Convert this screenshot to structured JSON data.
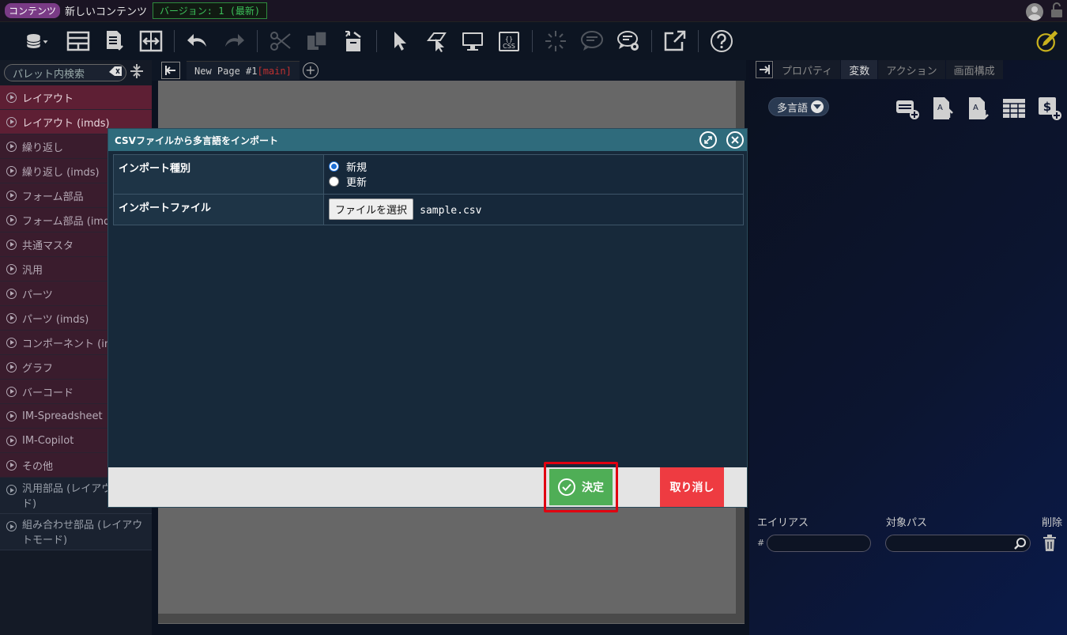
{
  "titlebar": {
    "tag": "コンテンツ",
    "title": "新しいコンテンツ",
    "version": "バージョン: 1 (最新)"
  },
  "toolbar": {
    "icons": [
      "database-icon",
      "layout-icon",
      "download-icon",
      "resize-icon",
      "undo-icon",
      "redo-icon",
      "cut-icon",
      "copy-icon",
      "paste-icon",
      "pointer-icon",
      "select-area-icon",
      "monitor-icon",
      "css-icon",
      "spinner-icon",
      "comment-icon",
      "comment-settings-icon",
      "external-link-icon",
      "help-icon",
      "edit-icon"
    ],
    "css_label": "CSS"
  },
  "palette": {
    "search_placeholder": "パレット内検索",
    "items": [
      "レイアウト",
      "レイアウト (imds)",
      "繰り返し",
      "繰り返し (imds)",
      "フォーム部品",
      "フォーム部品 (imds)",
      "共通マスタ",
      "汎用",
      "パーツ",
      "パーツ (imds)",
      "コンポーネント (imds)",
      "グラフ",
      "バーコード",
      "IM-Spreadsheet",
      "IM-Copilot",
      "その他"
    ],
    "group_items": [
      "汎用部品 (レイアウトモード)",
      "組み合わせ部品 (レイアウトモード)"
    ]
  },
  "canvas": {
    "page_tab_name": "New Page #1",
    "page_tab_branch": "[main]"
  },
  "right_panel": {
    "tabs": [
      "プロパティ",
      "変数",
      "アクション",
      "画面構成"
    ],
    "active_tab": "変数",
    "lang_button": "多言語",
    "alias_header": "エイリアス",
    "path_header": "対象パス",
    "delete_header": "削除",
    "hash": "#"
  },
  "modal": {
    "title": "CSVファイルから多言語をインポート",
    "import_type_label": "インポート種別",
    "options": [
      "新規",
      "更新"
    ],
    "selected_option": "新規",
    "import_file_label": "インポートファイル",
    "file_button": "ファイルを選択",
    "file_name": "sample.csv",
    "ok_label": "決定",
    "cancel_label": "取り消し"
  },
  "colors": {
    "modal_header": "#2f6b7c",
    "ok": "#4fae56",
    "cancel": "#ee3b41",
    "highlight": "#e00010",
    "palette_item": "#3a1c2d",
    "version_green": "#3cc05a"
  }
}
